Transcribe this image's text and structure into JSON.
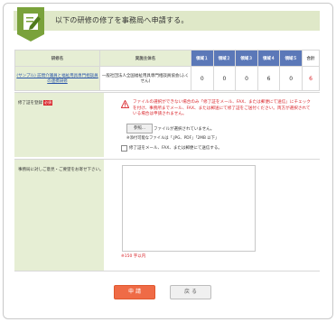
{
  "header": {
    "title": "以下の研修の修了を事務局へ申請する。"
  },
  "table": {
    "headers": {
      "course": "研修名",
      "org": "実施主体名",
      "area1": "領域１",
      "area2": "領域２",
      "area3": "領域３",
      "area4": "領域４",
      "area5": "領域５",
      "total": "合計"
    },
    "row": {
      "course": "(サンプル) 訪問介護員と福祉用具専門相談員の連携研修",
      "org": "一般社団法人全国福祉用具専門相談員協会(ふくせん)",
      "area1": "0",
      "area2": "0",
      "area3": "0",
      "area4": "6",
      "area5": "0",
      "total": "6"
    }
  },
  "certificate": {
    "label": "修了証を登録",
    "required": "必須",
    "warning": "ファイルの選択ができない場合のみ「修了証をメール、FAX、または郵便にて送信」にチェックを付け、事務所までメール、FAX、または郵送にて修了証をご送付ください。両方が選択されている場合は申請されません。",
    "browse_label": "参照...",
    "file_status": "ファイルが選択されていません。",
    "file_note": "※添付可能なファイルは「.JPG、PDF」「2MB 以下」",
    "checkbox_label": "修了証をメール、FAX、または郵便にて送信する。"
  },
  "comment": {
    "label": "事務局に対しご意見・ご要望をお寄せ下さい。",
    "char_limit": "※150 字以内"
  },
  "buttons": {
    "apply": "申 請",
    "back": "戻 る"
  }
}
